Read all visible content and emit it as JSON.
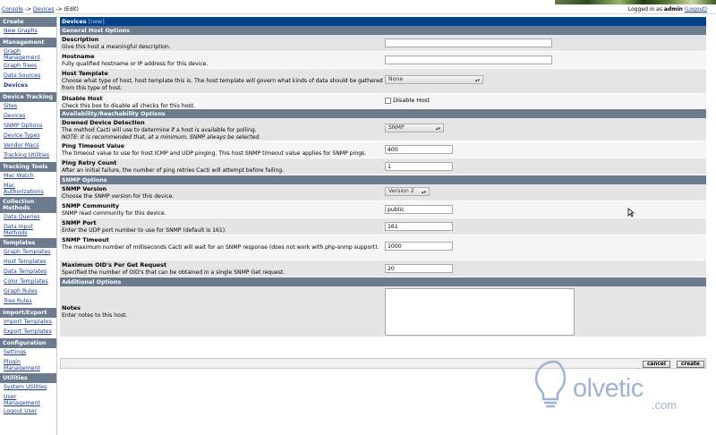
{
  "breadcrumb": {
    "console": "Console",
    "sep1": "->",
    "devices": "Devices",
    "sep2": "->",
    "edit": "(Edit)"
  },
  "login": {
    "prefix": "Logged in as",
    "user": "admin",
    "logout": "(Logout)"
  },
  "sidebar": [
    {
      "type": "head",
      "label": "Create"
    },
    {
      "type": "item",
      "label": "New Graphs"
    },
    {
      "type": "head",
      "label": "Management"
    },
    {
      "type": "item",
      "label": "Graph Management"
    },
    {
      "type": "item",
      "label": "Graph Trees"
    },
    {
      "type": "item",
      "label": "Data Sources"
    },
    {
      "type": "item",
      "label": "Devices",
      "active": true
    },
    {
      "type": "head",
      "label": "Device Tracking"
    },
    {
      "type": "item",
      "label": "Sites"
    },
    {
      "type": "item",
      "label": "Devices"
    },
    {
      "type": "item",
      "label": "SNMP Options"
    },
    {
      "type": "item",
      "label": "Device Types"
    },
    {
      "type": "item",
      "label": "Vendor Macs"
    },
    {
      "type": "item",
      "label": "Tracking Utilities"
    },
    {
      "type": "head",
      "label": "Tracking Tools"
    },
    {
      "type": "item",
      "label": "Mac Watch"
    },
    {
      "type": "item",
      "label": "Mac Authorizations"
    },
    {
      "type": "head",
      "label": "Collection Methods"
    },
    {
      "type": "item",
      "label": "Data Queries"
    },
    {
      "type": "item",
      "label": "Data Input Methods"
    },
    {
      "type": "head",
      "label": "Templates"
    },
    {
      "type": "item",
      "label": "Graph Templates"
    },
    {
      "type": "item",
      "label": "Host Templates"
    },
    {
      "type": "item",
      "label": "Data Templates"
    },
    {
      "type": "item",
      "label": "Color Templates"
    },
    {
      "type": "item",
      "label": "Graph Rules"
    },
    {
      "type": "item",
      "label": "Tree Rules"
    },
    {
      "type": "head",
      "label": "Import/Export"
    },
    {
      "type": "item",
      "label": "Import Templates"
    },
    {
      "type": "item",
      "label": "Export Templates"
    },
    {
      "type": "head",
      "label": "Configuration"
    },
    {
      "type": "item",
      "label": "Settings"
    },
    {
      "type": "item",
      "label": "Plugin Management"
    },
    {
      "type": "head",
      "label": "Utilities"
    },
    {
      "type": "item",
      "label": "System Utilities"
    },
    {
      "type": "item",
      "label": "User Management"
    },
    {
      "type": "item",
      "label": "Logout User"
    }
  ],
  "form": {
    "title": "Devices",
    "title_new": "[new]",
    "sections": {
      "general": "General Host Options",
      "availability": "Availability/Reachability Options",
      "snmp": "SNMP Options",
      "additional": "Additional Options"
    },
    "description": {
      "label": "Description",
      "desc": "Give this host a meaningful description.",
      "value": ""
    },
    "hostname": {
      "label": "Hostname",
      "desc": "Fully qualified hostname or IP address for this device.",
      "value": ""
    },
    "host_template": {
      "label": "Host Template",
      "desc": "Choose what type of host, host template this is. The host template will govern what kinds of data should be gathered from this type of host.",
      "value": "None"
    },
    "disable_host": {
      "label": "Disable Host",
      "desc": "Check this box to disable all checks for this host.",
      "checkbox_label": "Disable Host",
      "checked": false
    },
    "downed_detection": {
      "label": "Downed Device Detection",
      "desc": "The method Cacti will use to determine if a host is available for polling.",
      "note": "NOTE: It is recommended that, at a minimum, SNMP always be selected.",
      "value": "SNMP"
    },
    "ping_timeout": {
      "label": "Ping Timeout Value",
      "desc": "The timeout value to use for host ICMP and UDP pinging. This host SNMP timeout value applies for SNMP pings.",
      "value": "400"
    },
    "ping_retry": {
      "label": "Ping Retry Count",
      "desc": "After an initial failure, the number of ping retries Cacti will attempt before failing.",
      "value": "1"
    },
    "snmp_version": {
      "label": "SNMP Version",
      "desc": "Choose the SNMP version for this device.",
      "value": "Version 2"
    },
    "snmp_community": {
      "label": "SNMP Community",
      "desc": "SNMP read community for this device.",
      "value": "public"
    },
    "snmp_port": {
      "label": "SNMP Port",
      "desc": "Enter the UDP port number to use for SNMP (default is 161).",
      "value": "161"
    },
    "snmp_timeout": {
      "label": "SNMP Timeout",
      "desc": "The maximum number of milliseconds Cacti will wait for an SNMP response (does not work with php-snmp support).",
      "value": "1000"
    },
    "max_oids": {
      "label": "Maximum OID's Per Get Request",
      "desc": "Specified the number of OID's that can be obtained in a single SNMP Get request.",
      "value": "20"
    },
    "notes": {
      "label": "Notes",
      "desc": "Enter notes to this host.",
      "value": ""
    }
  },
  "buttons": {
    "cancel": "cancel",
    "create": "create"
  },
  "watermark": {
    "brand": "olvetic",
    "domain": ".com"
  }
}
